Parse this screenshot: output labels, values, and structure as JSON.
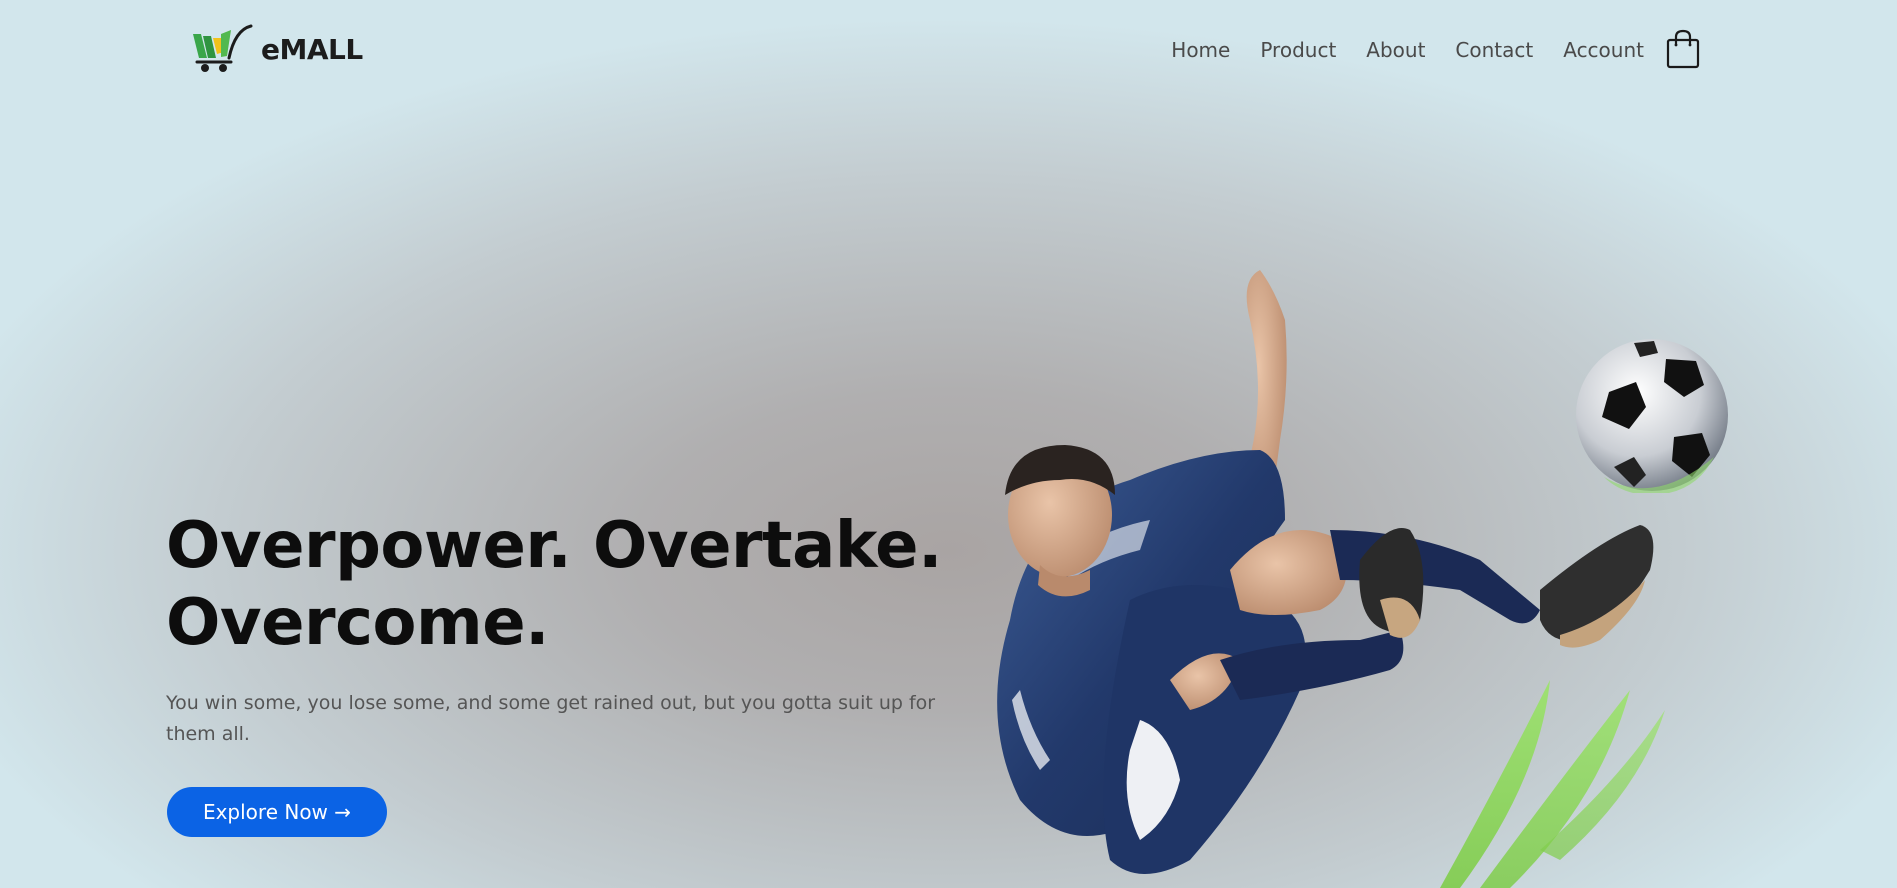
{
  "brand": {
    "name": "eMALL",
    "colors": {
      "green": "#3aa64a",
      "yellow": "#f2c21b",
      "dark": "#1c1c1c"
    }
  },
  "nav": {
    "items": [
      {
        "label": "Home"
      },
      {
        "label": "Product"
      },
      {
        "label": "About"
      },
      {
        "label": "Contact"
      },
      {
        "label": "Account"
      }
    ],
    "cart_icon": "shopping-bag-icon"
  },
  "hero": {
    "title_line1": "Overpower. Overtake.",
    "title_line2": "Overcome.",
    "description": "You win some, you lose some, and some get rained out, but you gotta suit up for them all.",
    "cta_label": "Explore Now →",
    "accent_color": "#0b63e5"
  }
}
